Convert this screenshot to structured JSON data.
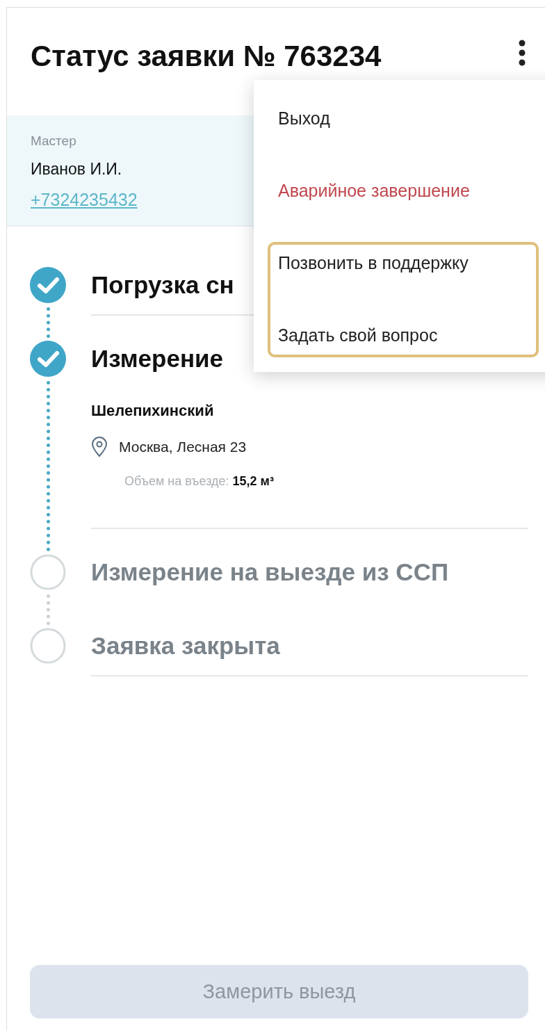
{
  "header": {
    "title": "Статус заявки № 763234"
  },
  "master": {
    "label": "Мастер",
    "name": "Иванов И.И.",
    "phone": "+7324235432"
  },
  "steps": [
    {
      "title": "Погрузка сн",
      "done": true,
      "divider": true
    },
    {
      "title": "Измерение",
      "done": true,
      "divider": true,
      "place": "Шелепихинский",
      "address": "Москва, Лесная 23",
      "volume_label": "Объем на въезде:",
      "volume_value": "15,2 м³"
    },
    {
      "title": "Измерение на выезде из ССП",
      "done": false,
      "divider": false
    },
    {
      "title": "Заявка закрыта",
      "done": false,
      "divider": true
    }
  ],
  "menu": {
    "items": [
      {
        "label": "Выход",
        "kind": "default",
        "highlighted": false
      },
      {
        "label": "Аварийное завершение",
        "kind": "danger",
        "highlighted": false
      },
      {
        "label": "Позвонить в поддержку",
        "kind": "default",
        "highlighted": true
      },
      {
        "label": "Задать свой вопрос",
        "kind": "default",
        "highlighted": true
      }
    ]
  },
  "action_button": {
    "label": "Замерить выезд",
    "disabled": true
  }
}
